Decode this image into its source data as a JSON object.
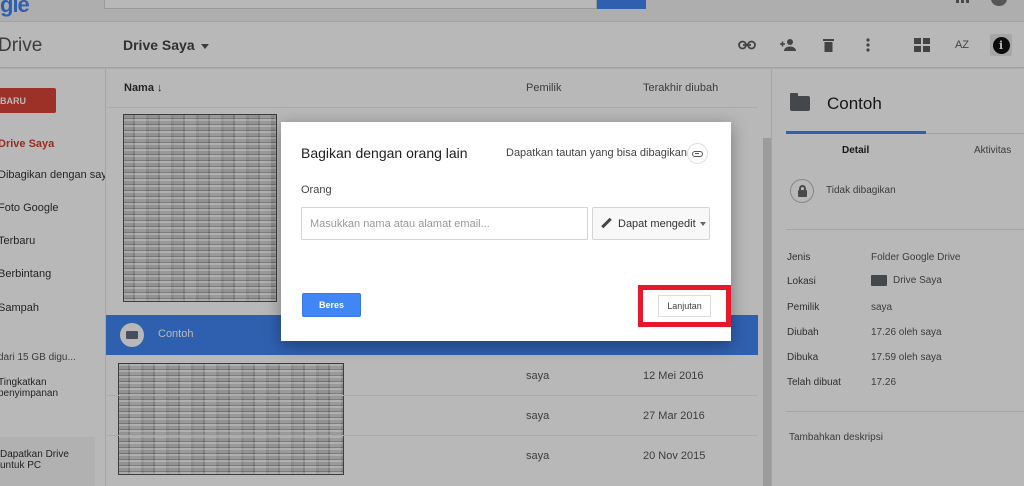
{
  "app": {
    "logo": "gle",
    "name": "Drive"
  },
  "header": {
    "title": "Drive Saya"
  },
  "toolbar_icons": [
    "link-icon",
    "add-person-icon",
    "trash-icon",
    "more-vert-icon",
    "grid-view-icon",
    "sort-az-icon",
    "info-icon"
  ],
  "toolbar": {
    "sort_label": "AZ",
    "info_label": "i"
  },
  "sidebar": {
    "new_label": "BARU",
    "items": [
      {
        "label": "Drive Saya",
        "active": true
      },
      {
        "label": "Dibagikan dengan saya"
      },
      {
        "label": "Foto Google"
      },
      {
        "label": "Terbaru"
      },
      {
        "label": "Berbintang"
      },
      {
        "label": "Sampah"
      }
    ],
    "storage": "dari 15 GB digu...",
    "upgrade": "Tingkatkan penyimpanan",
    "get_drive": "Dapatkan Drive untuk PC"
  },
  "list": {
    "columns": {
      "name": "Nama",
      "owner": "Pemilik",
      "modified": "Terakhir diubah"
    },
    "selected_folder": "Contoh",
    "rows": [
      {
        "owner": "saya",
        "modified": "12 Mei 2016"
      },
      {
        "owner": "saya",
        "modified": "27 Mar 2016"
      },
      {
        "owner": "saya",
        "modified": "20 Nov 2015"
      }
    ]
  },
  "details": {
    "title": "Contoh",
    "tabs": [
      "Detail",
      "Aktivitas"
    ],
    "sharing": "Tidak dibagikan",
    "props": [
      {
        "label": "Jenis",
        "value": "Folder Google Drive"
      },
      {
        "label": "Lokasi",
        "value": "Drive Saya"
      },
      {
        "label": "Pemilik",
        "value": "saya"
      },
      {
        "label": "Diubah",
        "value": "17.26 oleh saya"
      },
      {
        "label": "Dibuka",
        "value": "17.59 oleh saya"
      },
      {
        "label": "Telah dibuat",
        "value": "17.26"
      }
    ],
    "add_description": "Tambahkan deskripsi"
  },
  "dialog": {
    "title": "Bagikan dengan orang lain",
    "get_link": "Dapatkan tautan yang bisa dibagikan",
    "people_label": "Orang",
    "input_placeholder": "Masukkan nama atau alamat email...",
    "permission": "Dapat mengedit",
    "done": "Beres",
    "advanced": "Lanjutan"
  },
  "colors": {
    "accent": "#4285f4",
    "new_button": "#db4437",
    "highlight": "#e8182a"
  }
}
